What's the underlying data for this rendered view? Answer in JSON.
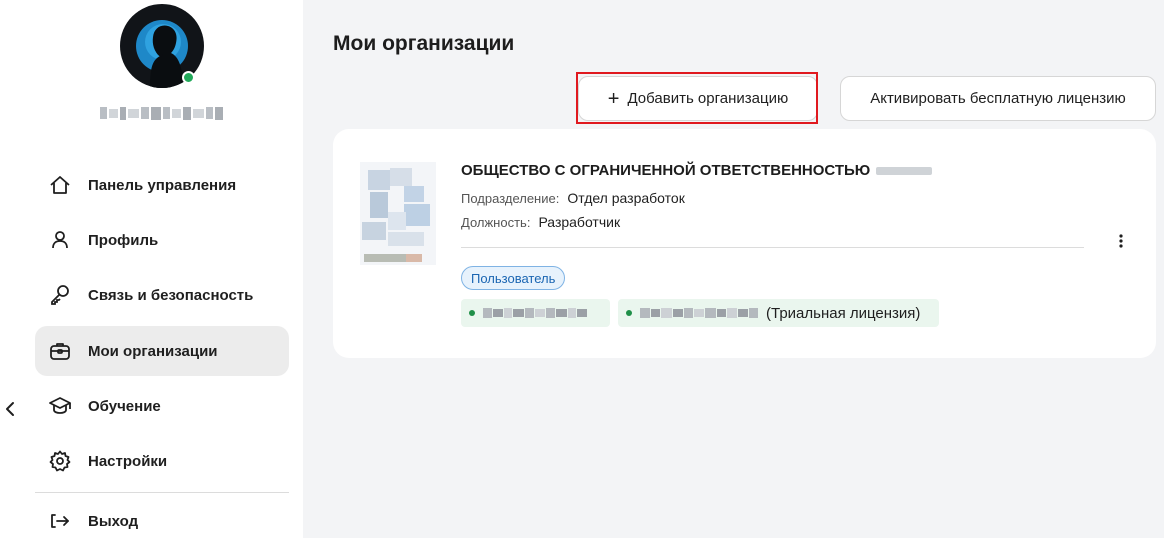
{
  "sidebar": {
    "username": "",
    "items": [
      {
        "label": "Панель управления",
        "icon": "home-icon"
      },
      {
        "label": "Профиль",
        "icon": "user-icon"
      },
      {
        "label": "Связь и безопасность",
        "icon": "key-icon"
      },
      {
        "label": "Мои организации",
        "icon": "briefcase-icon",
        "active": true
      },
      {
        "label": "Обучение",
        "icon": "graduation-cap-icon"
      },
      {
        "label": "Настройки",
        "icon": "gear-icon"
      },
      {
        "label": "Выход",
        "icon": "logout-icon"
      }
    ]
  },
  "main": {
    "title": "Мои организации",
    "add_button_label": "Добавить организацию",
    "activate_button_label": "Активировать бесплатную лицензию"
  },
  "organization": {
    "name": "ОБЩЕСТВО С ОГРАНИЧЕННОЙ ОТВЕТСТВЕННОСТЬЮ",
    "department_key": "Подразделение:",
    "department_value": "Отдел разработок",
    "position_key": "Должность:",
    "position_value": "Разработчик",
    "role_badge": "Пользователь",
    "licenses": [
      {
        "suffix": ""
      },
      {
        "suffix": "(Триальная лицензия)"
      }
    ]
  },
  "colors": {
    "accent_blue": "#1a65b2",
    "online_green": "#22a95a",
    "highlight_red": "#e0191f",
    "license_green": "#1f8f48"
  }
}
